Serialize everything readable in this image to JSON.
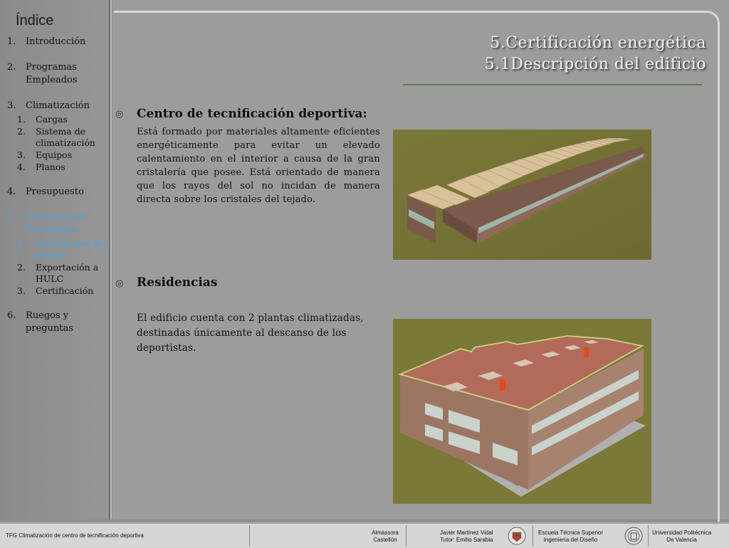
{
  "sidebar": {
    "title": "Índice",
    "items": [
      {
        "num": "1.",
        "label": "Introducción"
      },
      {
        "num": "2.",
        "label": "Programas Empleados"
      },
      {
        "num": "3.",
        "label": "Climatización",
        "sub": [
          {
            "num": "1.",
            "label": "Cargas"
          },
          {
            "num": "2.",
            "label": "Sistema de climatización"
          },
          {
            "num": "3.",
            "label": "Equipos"
          },
          {
            "num": "4.",
            "label": "Planos"
          }
        ]
      },
      {
        "num": "4.",
        "label": "Presupuesto"
      },
      {
        "num": "5.",
        "label": "Certificación Energética",
        "sub": [
          {
            "num": "1.",
            "label": "Descripción del edificio"
          },
          {
            "num": "2.",
            "label": "Exportación a HULC"
          },
          {
            "num": "3.",
            "label": "Certificación"
          }
        ]
      },
      {
        "num": "6.",
        "label": "Ruegos y preguntas"
      }
    ]
  },
  "header": {
    "line1": "5.Certificación energética",
    "line2": "5.1Descripción del edificio"
  },
  "section1": {
    "bullet": "◎",
    "title": "Centro de tecnificación deportiva:",
    "text": "Está formado por materiales altamente eficientes energéticamente para evitar un elevado calentamiento en el interior a causa de la gran cristalería que posee. Está orientado de manera que los rayos del sol no incidan de manera directa sobre los cristales del tejado."
  },
  "section2": {
    "bullet": "◎",
    "title": "Residencias",
    "text_line1": "El edificio cuenta con 2 plantas climatizadas,",
    "text_line2": "destinadas únicamente al descanso de los",
    "text_line3": "deportistas."
  },
  "footer": {
    "project": "TFG Climatización de centro de tecnificación deportiva",
    "place1": "Almàssora",
    "place2": "Castellón",
    "author1": "Javier Martínez Vidal",
    "author2": "Tutor: Emilio Sarabia",
    "school1": "Escuela Técnica Superior",
    "school2": "Ingeniería del Diseño",
    "uni1": "Universidad Politécnica",
    "uni2": "De Valencia"
  },
  "colors": {
    "active": "#4aa3e0",
    "grass": "#7d7a3a",
    "roof_residence": "#b0675a",
    "header_rule": "#5d7a52"
  }
}
